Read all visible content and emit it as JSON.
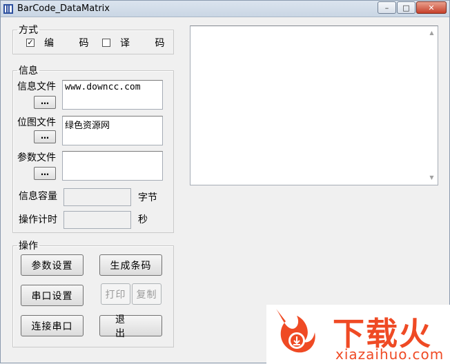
{
  "window": {
    "title": "BarCode_DataMatrix",
    "minimize_icon": "minimize-icon",
    "maximize_icon": "maximize-icon",
    "close_icon": "close-icon",
    "close_glyph": "✕",
    "maximize_glyph": "□",
    "minimize_glyph": "–"
  },
  "mode": {
    "legend": "方式",
    "encode": {
      "label": "编 码",
      "checked": true,
      "mark": "✓"
    },
    "decode": {
      "label": "译 码",
      "checked": false,
      "mark": ""
    }
  },
  "info": {
    "legend": "信息",
    "message_file": {
      "label": "信息文件",
      "button": "…",
      "value": "www.downcc.com"
    },
    "bitmap_file": {
      "label": "位图文件",
      "button": "…",
      "value": "绿色资源网"
    },
    "param_file": {
      "label": "参数文件",
      "button": "…",
      "value": ""
    },
    "capacity": {
      "label": "信息容量",
      "value": "",
      "unit": "字节"
    },
    "timer": {
      "label": "操作计时",
      "value": "",
      "unit": "秒"
    }
  },
  "ops": {
    "legend": "操作",
    "param_settings": "参数设置",
    "generate": "生成条码",
    "serial_settings": "串口设置",
    "print": "打印",
    "copy": "复制",
    "connect_serial": "连接串口",
    "exit": "退 出"
  },
  "watermark": {
    "brand": "下载火",
    "url": "xiazaihuo.com",
    "accent": "#ef4a24"
  }
}
